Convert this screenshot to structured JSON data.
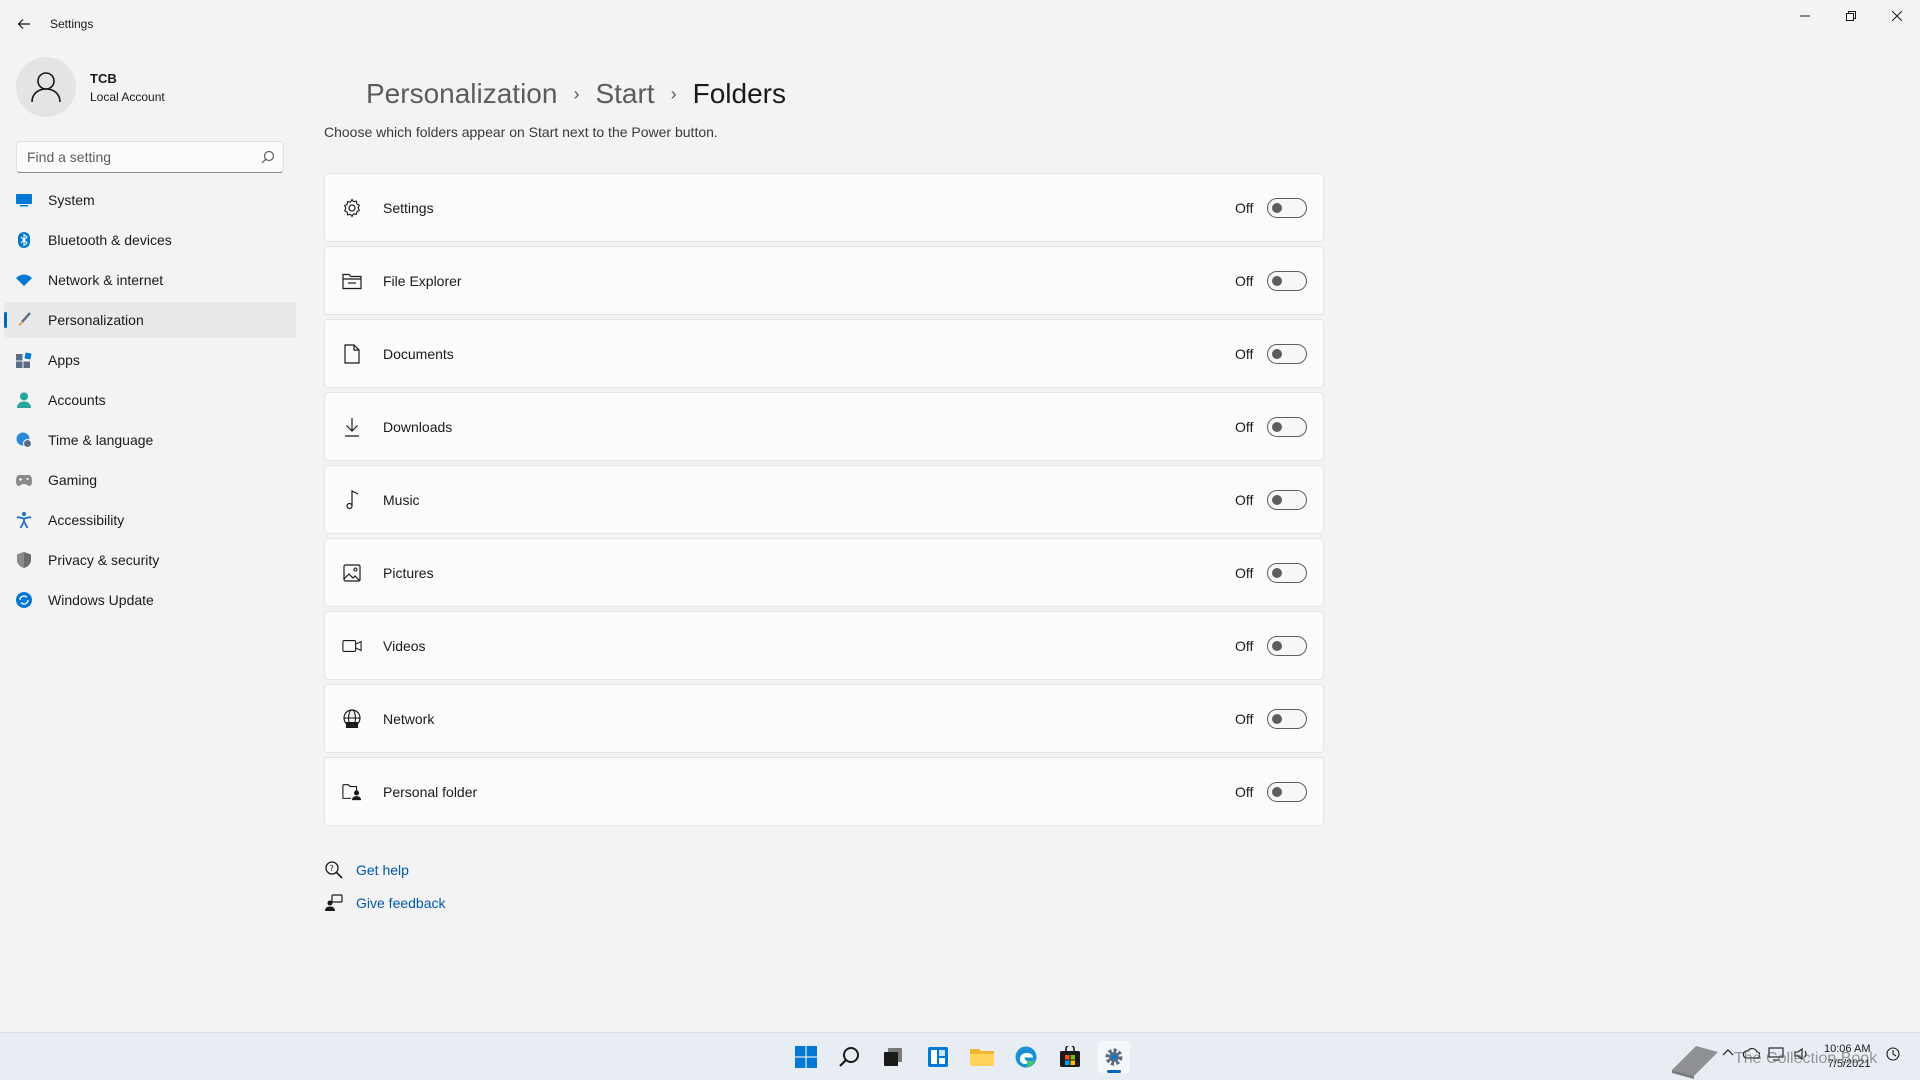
{
  "window": {
    "title": "Settings"
  },
  "profile": {
    "name": "TCB",
    "account_type": "Local Account"
  },
  "search": {
    "placeholder": "Find a setting"
  },
  "sidebar": {
    "items": [
      {
        "label": "System",
        "icon": "system-icon",
        "color": "#0078d4"
      },
      {
        "label": "Bluetooth & devices",
        "icon": "bluetooth-icon",
        "color": "#0078d4"
      },
      {
        "label": "Network & internet",
        "icon": "wifi-icon",
        "color": "#0078d4"
      },
      {
        "label": "Personalization",
        "icon": "brush-icon",
        "color": "#e8a33b",
        "active": true
      },
      {
        "label": "Apps",
        "icon": "apps-icon",
        "color": "#5a6b85"
      },
      {
        "label": "Accounts",
        "icon": "accounts-icon",
        "color": "#26a69a"
      },
      {
        "label": "Time & language",
        "icon": "globe-clock-icon",
        "color": "#2b88d8"
      },
      {
        "label": "Gaming",
        "icon": "gamepad-icon",
        "color": "#7a7a7a"
      },
      {
        "label": "Accessibility",
        "icon": "accessibility-icon",
        "color": "#1b6ec2"
      },
      {
        "label": "Privacy & security",
        "icon": "shield-icon",
        "color": "#6b6b6b"
      },
      {
        "label": "Windows Update",
        "icon": "update-icon",
        "color": "#0078d4"
      }
    ]
  },
  "breadcrumb": {
    "level1": "Personalization",
    "level2": "Start",
    "current": "Folders"
  },
  "description": "Choose which folders appear on Start next to the Power button.",
  "folders": [
    {
      "label": "Settings",
      "icon": "gear-icon",
      "state": "Off"
    },
    {
      "label": "File Explorer",
      "icon": "file-explorer-icon",
      "state": "Off"
    },
    {
      "label": "Documents",
      "icon": "document-icon",
      "state": "Off"
    },
    {
      "label": "Downloads",
      "icon": "download-icon",
      "state": "Off"
    },
    {
      "label": "Music",
      "icon": "music-note-icon",
      "state": "Off"
    },
    {
      "label": "Pictures",
      "icon": "picture-icon",
      "state": "Off"
    },
    {
      "label": "Videos",
      "icon": "video-icon",
      "state": "Off"
    },
    {
      "label": "Network",
      "icon": "network-globe-icon",
      "state": "Off"
    },
    {
      "label": "Personal folder",
      "icon": "personal-folder-icon",
      "state": "Off"
    }
  ],
  "help": {
    "get_help": "Get help",
    "give_feedback": "Give feedback"
  },
  "taskbar": {
    "icons": [
      "windows-start-icon",
      "search-icon",
      "task-view-icon",
      "widgets-icon",
      "file-explorer-icon",
      "edge-icon",
      "store-icon",
      "settings-app-icon"
    ],
    "active": "settings-app-icon"
  },
  "tray": {
    "time": "10:06 AM",
    "date": "7/5/2021"
  },
  "watermark": {
    "text": "The Collection Book"
  },
  "colors": {
    "accent": "#0067c0",
    "link": "#0058b0",
    "background": "#f3f3f3",
    "card": "#fbfbfb"
  }
}
